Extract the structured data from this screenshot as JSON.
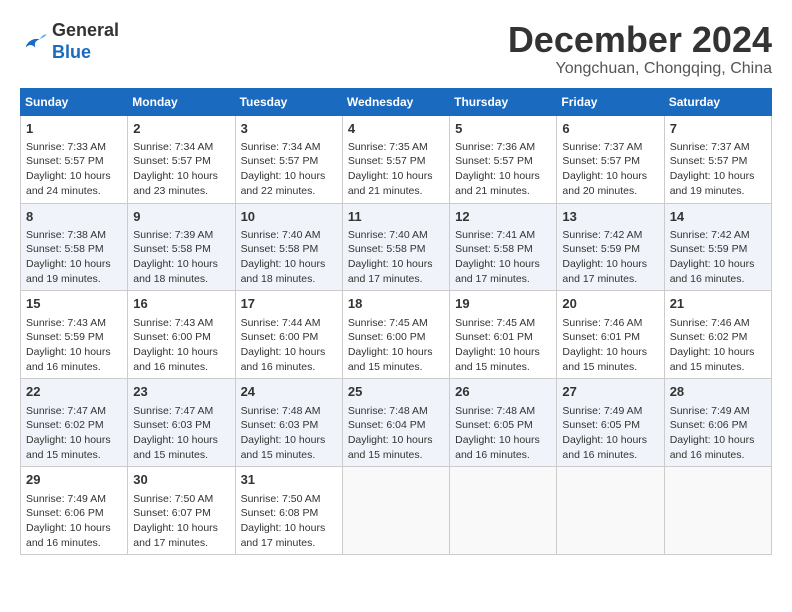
{
  "header": {
    "logo_general": "General",
    "logo_blue": "Blue",
    "month_title": "December 2024",
    "location": "Yongchuan, Chongqing, China"
  },
  "days_of_week": [
    "Sunday",
    "Monday",
    "Tuesday",
    "Wednesday",
    "Thursday",
    "Friday",
    "Saturday"
  ],
  "weeks": [
    [
      {
        "day": "1",
        "sunrise": "7:33 AM",
        "sunset": "5:57 PM",
        "daylight": "10 hours and 24 minutes."
      },
      {
        "day": "2",
        "sunrise": "7:34 AM",
        "sunset": "5:57 PM",
        "daylight": "10 hours and 23 minutes."
      },
      {
        "day": "3",
        "sunrise": "7:34 AM",
        "sunset": "5:57 PM",
        "daylight": "10 hours and 22 minutes."
      },
      {
        "day": "4",
        "sunrise": "7:35 AM",
        "sunset": "5:57 PM",
        "daylight": "10 hours and 21 minutes."
      },
      {
        "day": "5",
        "sunrise": "7:36 AM",
        "sunset": "5:57 PM",
        "daylight": "10 hours and 21 minutes."
      },
      {
        "day": "6",
        "sunrise": "7:37 AM",
        "sunset": "5:57 PM",
        "daylight": "10 hours and 20 minutes."
      },
      {
        "day": "7",
        "sunrise": "7:37 AM",
        "sunset": "5:57 PM",
        "daylight": "10 hours and 19 minutes."
      }
    ],
    [
      {
        "day": "8",
        "sunrise": "7:38 AM",
        "sunset": "5:58 PM",
        "daylight": "10 hours and 19 minutes."
      },
      {
        "day": "9",
        "sunrise": "7:39 AM",
        "sunset": "5:58 PM",
        "daylight": "10 hours and 18 minutes."
      },
      {
        "day": "10",
        "sunrise": "7:40 AM",
        "sunset": "5:58 PM",
        "daylight": "10 hours and 18 minutes."
      },
      {
        "day": "11",
        "sunrise": "7:40 AM",
        "sunset": "5:58 PM",
        "daylight": "10 hours and 17 minutes."
      },
      {
        "day": "12",
        "sunrise": "7:41 AM",
        "sunset": "5:58 PM",
        "daylight": "10 hours and 17 minutes."
      },
      {
        "day": "13",
        "sunrise": "7:42 AM",
        "sunset": "5:59 PM",
        "daylight": "10 hours and 17 minutes."
      },
      {
        "day": "14",
        "sunrise": "7:42 AM",
        "sunset": "5:59 PM",
        "daylight": "10 hours and 16 minutes."
      }
    ],
    [
      {
        "day": "15",
        "sunrise": "7:43 AM",
        "sunset": "5:59 PM",
        "daylight": "10 hours and 16 minutes."
      },
      {
        "day": "16",
        "sunrise": "7:43 AM",
        "sunset": "6:00 PM",
        "daylight": "10 hours and 16 minutes."
      },
      {
        "day": "17",
        "sunrise": "7:44 AM",
        "sunset": "6:00 PM",
        "daylight": "10 hours and 16 minutes."
      },
      {
        "day": "18",
        "sunrise": "7:45 AM",
        "sunset": "6:00 PM",
        "daylight": "10 hours and 15 minutes."
      },
      {
        "day": "19",
        "sunrise": "7:45 AM",
        "sunset": "6:01 PM",
        "daylight": "10 hours and 15 minutes."
      },
      {
        "day": "20",
        "sunrise": "7:46 AM",
        "sunset": "6:01 PM",
        "daylight": "10 hours and 15 minutes."
      },
      {
        "day": "21",
        "sunrise": "7:46 AM",
        "sunset": "6:02 PM",
        "daylight": "10 hours and 15 minutes."
      }
    ],
    [
      {
        "day": "22",
        "sunrise": "7:47 AM",
        "sunset": "6:02 PM",
        "daylight": "10 hours and 15 minutes."
      },
      {
        "day": "23",
        "sunrise": "7:47 AM",
        "sunset": "6:03 PM",
        "daylight": "10 hours and 15 minutes."
      },
      {
        "day": "24",
        "sunrise": "7:48 AM",
        "sunset": "6:03 PM",
        "daylight": "10 hours and 15 minutes."
      },
      {
        "day": "25",
        "sunrise": "7:48 AM",
        "sunset": "6:04 PM",
        "daylight": "10 hours and 15 minutes."
      },
      {
        "day": "26",
        "sunrise": "7:48 AM",
        "sunset": "6:05 PM",
        "daylight": "10 hours and 16 minutes."
      },
      {
        "day": "27",
        "sunrise": "7:49 AM",
        "sunset": "6:05 PM",
        "daylight": "10 hours and 16 minutes."
      },
      {
        "day": "28",
        "sunrise": "7:49 AM",
        "sunset": "6:06 PM",
        "daylight": "10 hours and 16 minutes."
      }
    ],
    [
      {
        "day": "29",
        "sunrise": "7:49 AM",
        "sunset": "6:06 PM",
        "daylight": "10 hours and 16 minutes."
      },
      {
        "day": "30",
        "sunrise": "7:50 AM",
        "sunset": "6:07 PM",
        "daylight": "10 hours and 17 minutes."
      },
      {
        "day": "31",
        "sunrise": "7:50 AM",
        "sunset": "6:08 PM",
        "daylight": "10 hours and 17 minutes."
      },
      null,
      null,
      null,
      null
    ]
  ],
  "labels": {
    "sunrise": "Sunrise:",
    "sunset": "Sunset:",
    "daylight": "Daylight:"
  }
}
